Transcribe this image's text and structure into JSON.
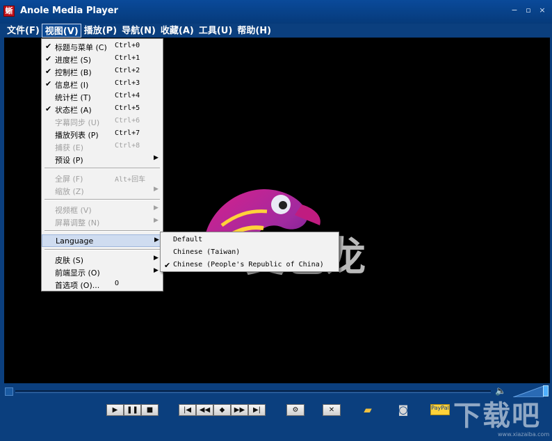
{
  "window": {
    "title": "Anole Media Player",
    "icon_text": "蜥",
    "controls": [
      "minimize-icon",
      "restore-icon",
      "close-icon"
    ]
  },
  "menubar": [
    {
      "label": "文件(F)",
      "active": false
    },
    {
      "label": "视图(V)",
      "active": true
    },
    {
      "label": "播放(P)",
      "active": false
    },
    {
      "label": "导航(N)",
      "active": false
    },
    {
      "label": "收藏(A)",
      "active": false
    },
    {
      "label": "工具(U)",
      "active": false
    },
    {
      "label": "帮助(H)",
      "active": false
    }
  ],
  "view_menu": {
    "items": [
      {
        "label": "标题与菜单 (C)",
        "shortcut": "Ctrl+0",
        "checked": true
      },
      {
        "label": "进度栏 (S)",
        "shortcut": "Ctrl+1",
        "checked": true
      },
      {
        "label": "控制栏 (B)",
        "shortcut": "Ctrl+2",
        "checked": true
      },
      {
        "label": "信息栏 (I)",
        "shortcut": "Ctrl+3",
        "checked": true
      },
      {
        "label": "统计栏 (T)",
        "shortcut": "Ctrl+4",
        "checked": false
      },
      {
        "label": "状态栏 (A)",
        "shortcut": "Ctrl+5",
        "checked": true
      },
      {
        "label": "字幕同步 (U)",
        "shortcut": "Ctrl+6",
        "disabled": true
      },
      {
        "label": "播放列表 (P)",
        "shortcut": "Ctrl+7"
      },
      {
        "label": "捕获 (E)",
        "shortcut": "Ctrl+8",
        "disabled": true
      },
      {
        "label": "预设 (P)",
        "submenu": true
      },
      {
        "label": "全屏 (F)",
        "shortcut": "Alt+回车",
        "disabled": true
      },
      {
        "label": "缩放 (Z)",
        "submenu": true,
        "disabled": true
      },
      {
        "label": "视频框 (V)",
        "submenu": true,
        "disabled": true
      },
      {
        "label": "屏幕调整 (N)",
        "submenu": true,
        "disabled": true
      },
      {
        "label": "Language",
        "submenu": true,
        "highlighted": true
      },
      {
        "label": "皮肤 (S)",
        "submenu": true
      },
      {
        "label": "前端显示 (O)",
        "submenu": true
      },
      {
        "label": "首选项 (O)...",
        "shortcut": "O"
      }
    ]
  },
  "language_submenu": [
    {
      "label": "Default",
      "checked": false
    },
    {
      "label": "Chinese (Taiwan)",
      "checked": false
    },
    {
      "label": "Chinese (People's Republic of China)",
      "checked": true
    }
  ],
  "logo": {
    "text": "变色龙"
  },
  "controls": {
    "playback_buttons": [
      "play-icon",
      "pause-icon",
      "stop-icon"
    ],
    "nav_buttons": [
      "skip-back-icon",
      "rewind-icon",
      "eject-icon",
      "fast-forward-icon",
      "skip-forward-icon"
    ],
    "tool_buttons": [
      "settings-icon",
      "fullscreen-icon",
      "open-folder-icon",
      "snapshot-icon",
      "paypal-icon"
    ],
    "paypal_label": "PayPal"
  },
  "watermark": {
    "text": "下载吧",
    "sub": "www.xiazaiba.com"
  }
}
